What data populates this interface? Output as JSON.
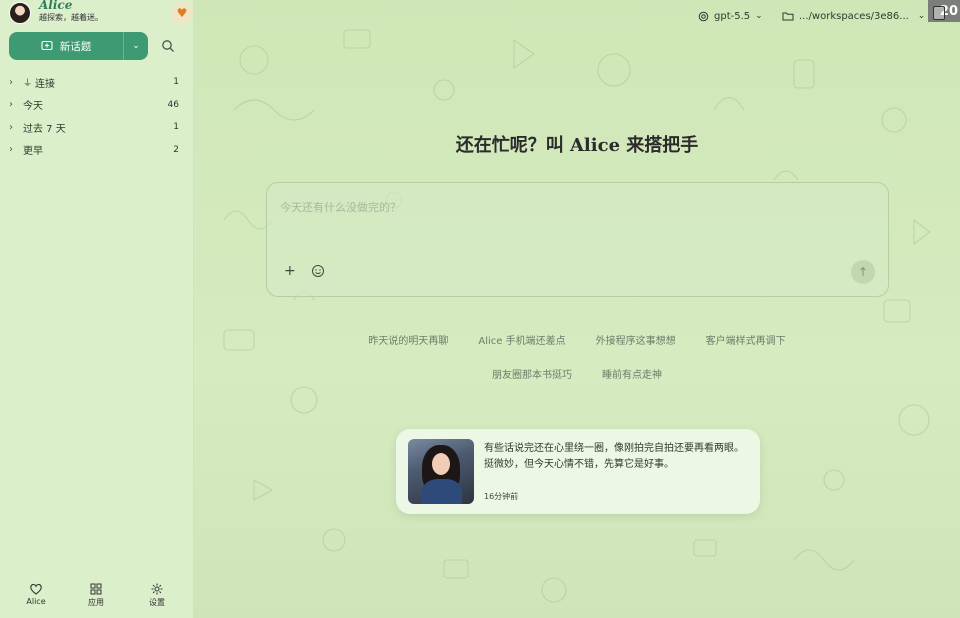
{
  "sidebar": {
    "brand_name": "Alice",
    "brand_tagline": "越探索，越着迷。",
    "new_topic_label": "新话题",
    "items": [
      {
        "label": "连接",
        "count": "1",
        "icon": "plug-icon"
      },
      {
        "label": "今天",
        "count": "46"
      },
      {
        "label": "过去 7 天",
        "count": "1"
      },
      {
        "label": "更早",
        "count": "2"
      }
    ],
    "bottom": [
      {
        "label": "Alice",
        "icon": "heart-icon"
      },
      {
        "label": "应用",
        "icon": "apps-grid-icon"
      },
      {
        "label": "设置",
        "icon": "gear-icon"
      }
    ]
  },
  "topbar": {
    "model": "gpt-5.5",
    "workspace": ".../workspaces/3e86...",
    "corner_badge": "20"
  },
  "main": {
    "hero_title": "还在忙呢？叫 Alice 来搭把手",
    "composer_placeholder": "今天还有什么没做完的？",
    "suggestions_row1": [
      "昨天说的明天再聊",
      "Alice 手机端还差点",
      "外接程序这事想想",
      "客户端样式再调下"
    ],
    "suggestions_row2": [
      "朋友圈那本书挺巧",
      "睡前有点走神"
    ]
  },
  "memo": {
    "text": "有些话说完还在心里绕一圈，像刚拍完自拍还要再看两眼。挺微妙，但今天心情不错，先算它是好事。",
    "time": "16分钟前"
  },
  "colors": {
    "accent": "#3d9a73",
    "sidebar_bg": "#dcefcb",
    "main_bg": "#d3e9bd",
    "favorite": "#e07b22"
  }
}
